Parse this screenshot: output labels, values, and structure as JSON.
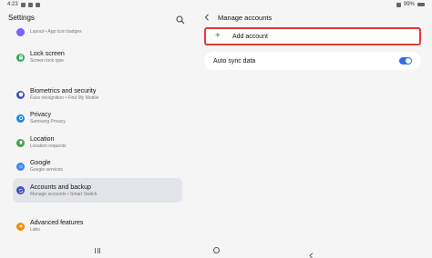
{
  "status": {
    "time": "4:23",
    "battery": "99%"
  },
  "left": {
    "title": "Settings",
    "items": [
      {
        "title": "",
        "subtitle": "Layout  •  App icon badges",
        "color": "#7b61ff"
      },
      {
        "title": "Lock screen",
        "subtitle": "Screen lock type",
        "color": "#34a853"
      },
      {
        "title": "Biometrics and security",
        "subtitle": "Face recognition  •  Find My Mobile",
        "color": "#3f51b5"
      },
      {
        "title": "Privacy",
        "subtitle": "Samsung Privacy",
        "color": "#1e88e5"
      },
      {
        "title": "Location",
        "subtitle": "Location requests",
        "color": "#43a047"
      },
      {
        "title": "Google",
        "subtitle": "Google services",
        "color": "#4285f4"
      },
      {
        "title": "Accounts and backup",
        "subtitle": "Manage accounts  •  Smart Switch",
        "color": "#3f51b5"
      },
      {
        "title": "Advanced features",
        "subtitle": "Labs",
        "color": "#fb8c00"
      }
    ]
  },
  "right": {
    "title": "Manage accounts",
    "add_account_label": "Add account",
    "auto_sync_label": "Auto sync data",
    "auto_sync_on": true
  },
  "colors": {
    "accent": "#2f6fde",
    "highlight_border": "#e53935",
    "plus": "#2e7d32"
  },
  "icons": {
    "search": "search-icon",
    "back": "back-arrow-icon"
  }
}
